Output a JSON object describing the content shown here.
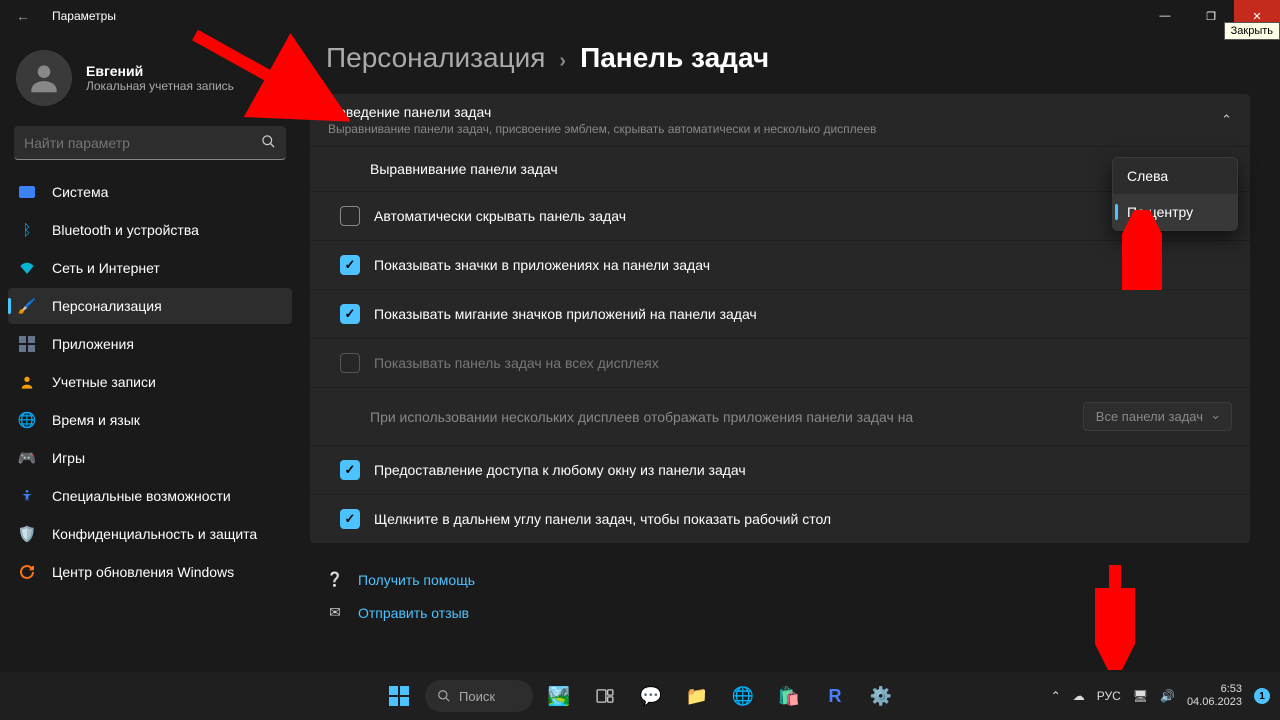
{
  "window": {
    "title": "Параметры",
    "close_tooltip": "Закрыть"
  },
  "profile": {
    "name": "Евгений",
    "subtitle": "Локальная учетная запись"
  },
  "search": {
    "placeholder": "Найти параметр"
  },
  "sidebar": {
    "items": [
      {
        "label": "Система",
        "icon": "monitor",
        "color": "#3b82f6"
      },
      {
        "label": "Bluetooth и устройства",
        "icon": "bluetooth",
        "color": "#0ea5e9"
      },
      {
        "label": "Сеть и Интернет",
        "icon": "wifi",
        "color": "#06b6d4"
      },
      {
        "label": "Персонализация",
        "icon": "brush",
        "color": "#a855f7",
        "active": true
      },
      {
        "label": "Приложения",
        "icon": "apps",
        "color": "#64748b"
      },
      {
        "label": "Учетные записи",
        "icon": "person",
        "color": "#f59e0b"
      },
      {
        "label": "Время и язык",
        "icon": "clock",
        "color": "#0891b2"
      },
      {
        "label": "Игры",
        "icon": "game",
        "color": "#22c55e"
      },
      {
        "label": "Специальные возможности",
        "icon": "access",
        "color": "#3b82f6"
      },
      {
        "label": "Конфиденциальность и защита",
        "icon": "shield",
        "color": "#64748b"
      },
      {
        "label": "Центр обновления Windows",
        "icon": "update",
        "color": "#f97316"
      }
    ]
  },
  "breadcrumb": {
    "root": "Персонализация",
    "page": "Панель задач"
  },
  "section": {
    "title": "Поведение панели задач",
    "desc": "Выравнивание панели задач, присвоение эмблем, скрывать автоматически и несколько дисплеев",
    "rows": {
      "alignment": "Выравнивание панели задач",
      "autohide": "Автоматически скрывать панель задач",
      "badges": "Показывать значки в приложениях на панели задач",
      "flashing": "Показывать мигание значков приложений на панели задач",
      "alldisplays": "Показывать панель задач на всех дисплеях",
      "multidisplay_text": "При использовании нескольких дисплеев отображать приложения панели задач на",
      "multidisplay_dd": "Все панели задач",
      "anywindow": "Предоставление доступа к любому окну из панели задач",
      "corner": "Щелкните в дальнем углу панели задач, чтобы показать рабочий стол"
    }
  },
  "popup": {
    "left": "Слева",
    "center": "По центру"
  },
  "links": {
    "help": "Получить помощь",
    "feedback": "Отправить отзыв"
  },
  "taskbar": {
    "search": "Поиск",
    "lang": "РУС",
    "time": "6:53",
    "date": "04.06.2023",
    "notif": "1"
  }
}
